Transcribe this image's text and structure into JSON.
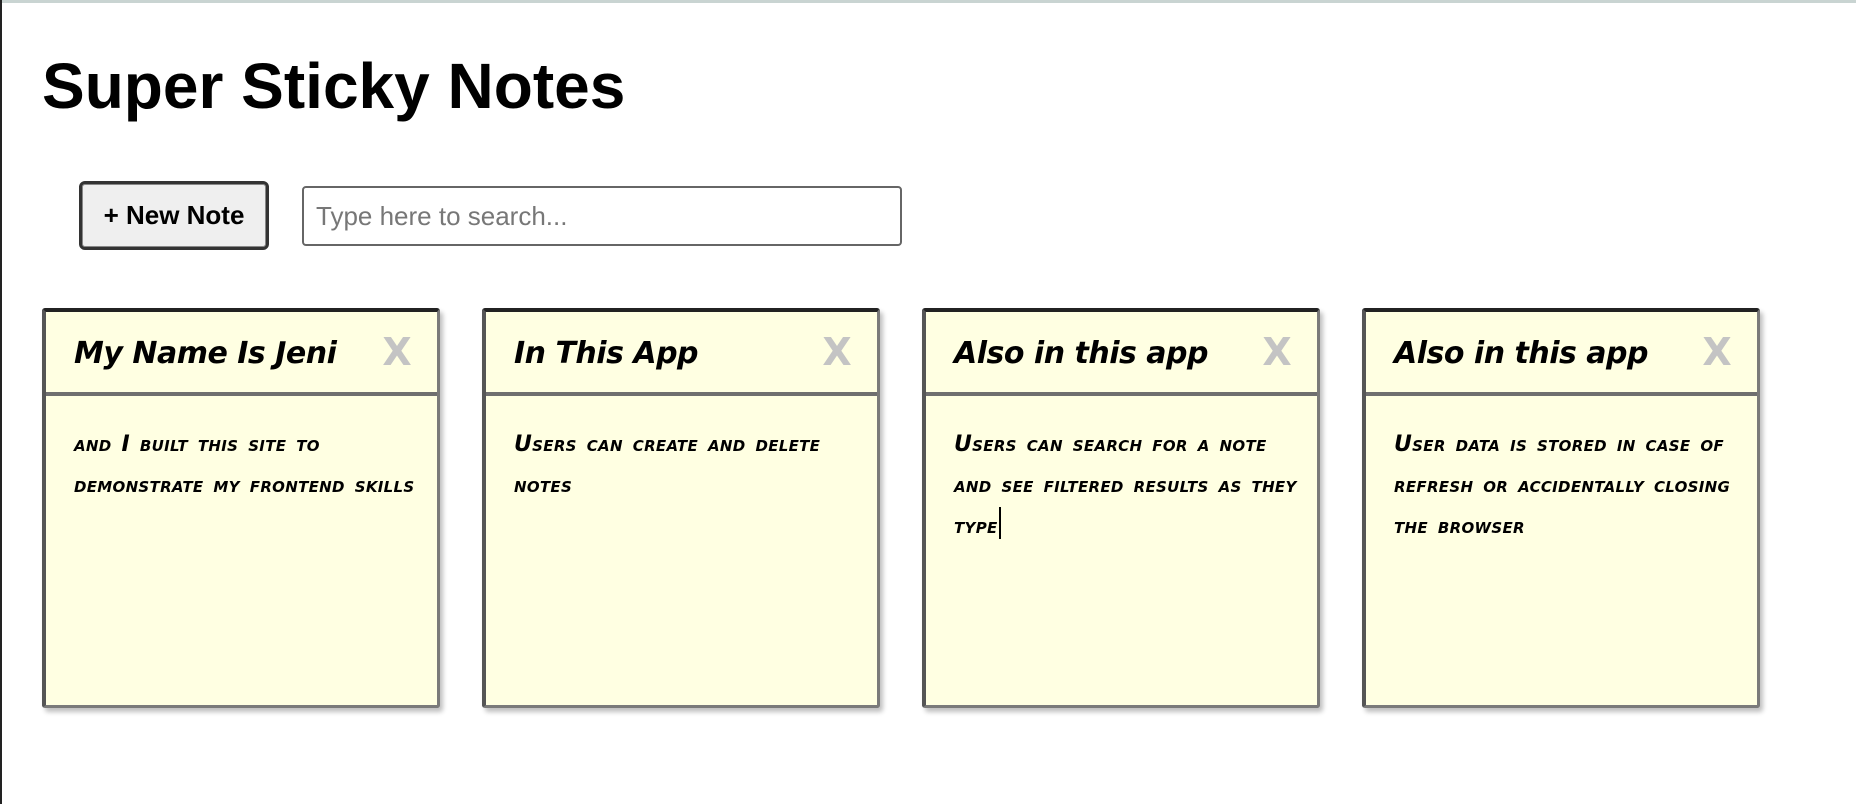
{
  "app": {
    "title": "Super Sticky Notes"
  },
  "toolbar": {
    "new_note_label": "+ New Note",
    "search_placeholder": "Type here to search...",
    "search_value": ""
  },
  "icons": {
    "close": "close-icon"
  },
  "colors": {
    "note_background": "#ffffe2",
    "close_icon": "#c4c4c4"
  },
  "notes": [
    {
      "title": "My Name Is Jeni",
      "description": "and I built this site to demonstrate my frontend skills",
      "close_label": "X"
    },
    {
      "title": "In This App",
      "description": "Users can create and delete notes",
      "close_label": "X"
    },
    {
      "title": "Also in this app",
      "description": "Users can search for a note and see filtered results as they type",
      "close_label": "X"
    },
    {
      "title": "Also in this app",
      "description": "User data is stored in case of refresh or accidentally closing the browser",
      "close_label": "X"
    }
  ]
}
